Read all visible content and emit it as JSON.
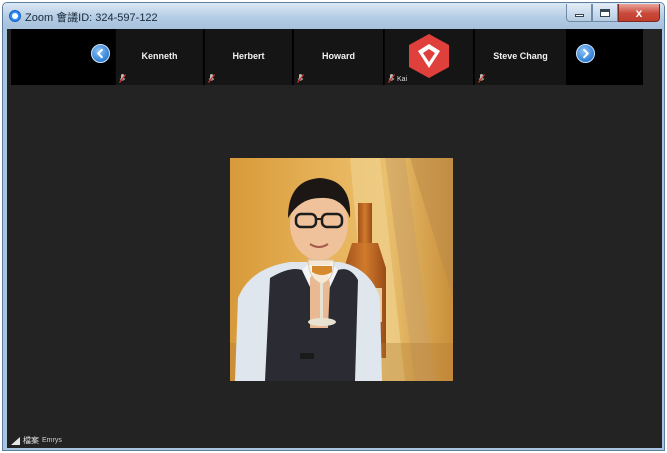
{
  "window": {
    "title": "Zoom 會議ID: 324-597-122",
    "controls": {
      "close_glyph": "x"
    }
  },
  "filmstrip": {
    "participants": [
      {
        "name": "Kenneth",
        "muted": true
      },
      {
        "name": "Herbert",
        "muted": true
      },
      {
        "name": "Howard",
        "muted": true
      },
      {
        "name": "",
        "caption": "Kai",
        "muted": true,
        "avatar": "red-hexagon-logo"
      },
      {
        "name": "Steve Chang",
        "muted": true
      }
    ]
  },
  "active_speaker": {
    "label": "檔案",
    "sub_label": "Emrys"
  },
  "colors": {
    "accent": "#2f7fd6",
    "logo_red": "#e0403c",
    "muted_icon": "#d63a2a",
    "background": "#232323"
  }
}
